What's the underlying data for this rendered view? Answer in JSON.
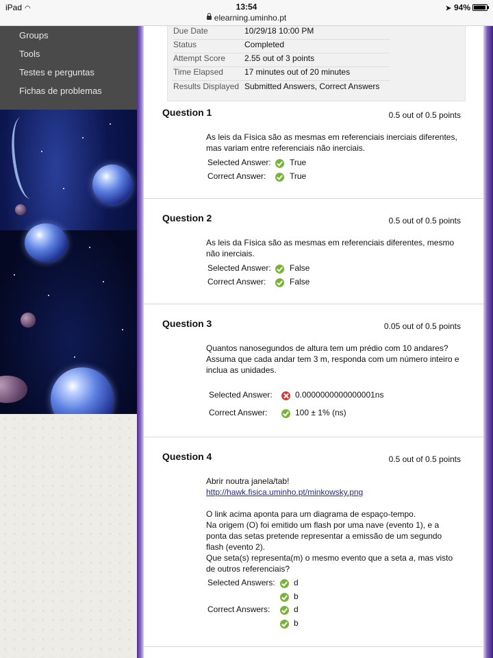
{
  "status_bar": {
    "device": "iPad",
    "time": "13:54",
    "url": "elearning.uminho.pt",
    "battery_percent": "94%",
    "battery_level": 0.94
  },
  "sidebar": {
    "items": [
      {
        "label": "Groups"
      },
      {
        "label": "Tools"
      },
      {
        "label": "Testes e perguntas"
      },
      {
        "label": "Fichas de problemas"
      }
    ]
  },
  "summary": {
    "rows": [
      {
        "label": "Due Date",
        "value": "10/29/18 10:00 PM"
      },
      {
        "label": "Status",
        "value": "Completed"
      },
      {
        "label": "Attempt Score",
        "value": "2.55 out of 3 points"
      },
      {
        "label": "Time Elapsed",
        "value": "17 minutes out of 20 minutes"
      },
      {
        "label": "Results Displayed",
        "value": "Submitted Answers, Correct Answers"
      }
    ]
  },
  "questions": [
    {
      "title": "Question 1",
      "points": "0.5 out of 0.5 points",
      "text": "As leis da Física são as mesmas em referenciais inerciais diferentes, mas variam entre referenciais não inerciais.",
      "selected_label": "Selected Answer:",
      "selected": "True",
      "correct_label": "Correct Answer:",
      "correct": "True"
    },
    {
      "title": "Question 2",
      "points": "0.5 out of 0.5 points",
      "text": "As leis da Física são as mesmas em referenciais diferentes, mesmo não inerciais.",
      "selected_label": "Selected Answer:",
      "selected": "False",
      "correct_label": "Correct Answer:",
      "correct": "False"
    },
    {
      "title": "Question 3",
      "points": "0.05 out of 0.5 points",
      "text": "Quantos nanosegundos de altura tem um prédio com 10 andares? Assuma que cada andar tem 3 m, responda com um número inteiro e inclua as unidades.",
      "selected_label": "Selected Answer:",
      "selected": "0.0000000000000001ns",
      "correct_label": "Correct Answer:",
      "correct": "100 ± 1% (ns)"
    },
    {
      "title": "Question 4",
      "points": "0.5 out of 0.5 points",
      "intro": "Abrir noutra janela/tab!",
      "link": "http://hawk.fisica.uminho.pt/minkowsky.png",
      "text_lines": [
        "O link acima aponta para um diagrama de espaço-tempo.",
        "Na origem (O) foi emitido um flash por uma nave (evento 1), e a",
        "ponta das setas pretende representar a emissão de um segundo",
        "flash (evento 2).",
        "Que seta(s) representa(m) o mesmo evento que a seta "
      ],
      "text_italic": "a",
      "text_tail": ", mas visto",
      "text_last": "de outros referenciais?",
      "selected_label": "Selected Answers:",
      "selected": [
        "d",
        "b"
      ],
      "correct_label": "Correct Answers:",
      "correct": [
        "d",
        "b"
      ]
    }
  ]
}
